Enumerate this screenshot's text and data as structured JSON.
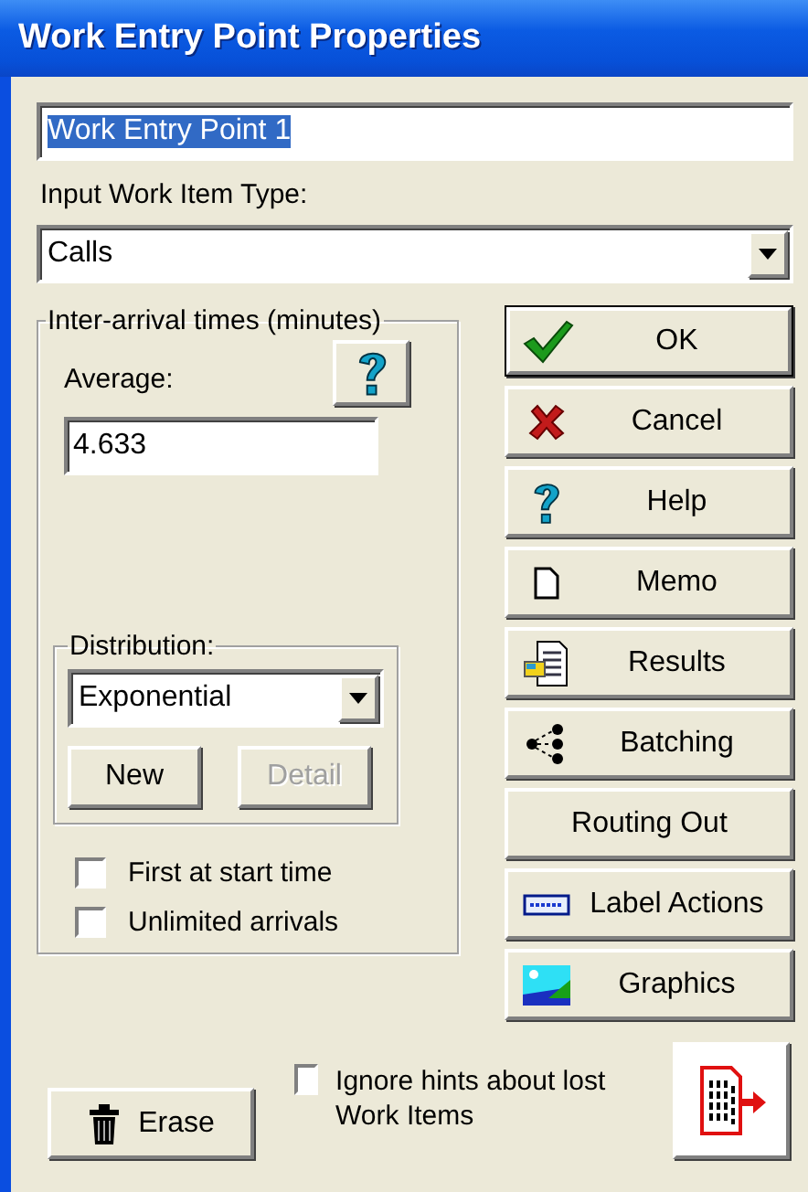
{
  "window": {
    "title": "Work Entry Point Properties"
  },
  "name_field": {
    "value": "Work Entry Point 1",
    "selected": true
  },
  "work_item_type": {
    "label": "Input Work Item Type:",
    "value": "Calls"
  },
  "inter_arrival": {
    "title": "Inter-arrival times (minutes)",
    "average_label": "Average:",
    "average_value": "4.633",
    "distribution": {
      "title": "Distribution:",
      "value": "Exponential",
      "buttons": [
        {
          "label": "New",
          "disabled": false
        },
        {
          "label": "Detail",
          "disabled": true
        }
      ]
    },
    "options": [
      {
        "label": "First at start time",
        "checked": false
      },
      {
        "label": "Unlimited arrivals",
        "checked": false
      }
    ]
  },
  "actions": [
    {
      "label": "OK",
      "kind": "check",
      "default": true
    },
    {
      "label": "Cancel",
      "kind": "cross",
      "default": false
    },
    {
      "label": "Help",
      "kind": "help",
      "default": false
    },
    {
      "label": "Memo",
      "kind": "memo",
      "default": false
    },
    {
      "label": "Results",
      "kind": "results",
      "default": false
    },
    {
      "label": "Batching",
      "kind": "batching",
      "default": false
    },
    {
      "label": "Routing Out",
      "kind": "none",
      "default": false
    },
    {
      "label": "Label Actions",
      "kind": "label",
      "default": false
    },
    {
      "label": "Graphics",
      "kind": "graphics",
      "default": false
    }
  ],
  "erase_button": {
    "label": "Erase"
  },
  "ignore_hints": {
    "label": "Ignore hints about lost Work Items",
    "checked": false
  }
}
